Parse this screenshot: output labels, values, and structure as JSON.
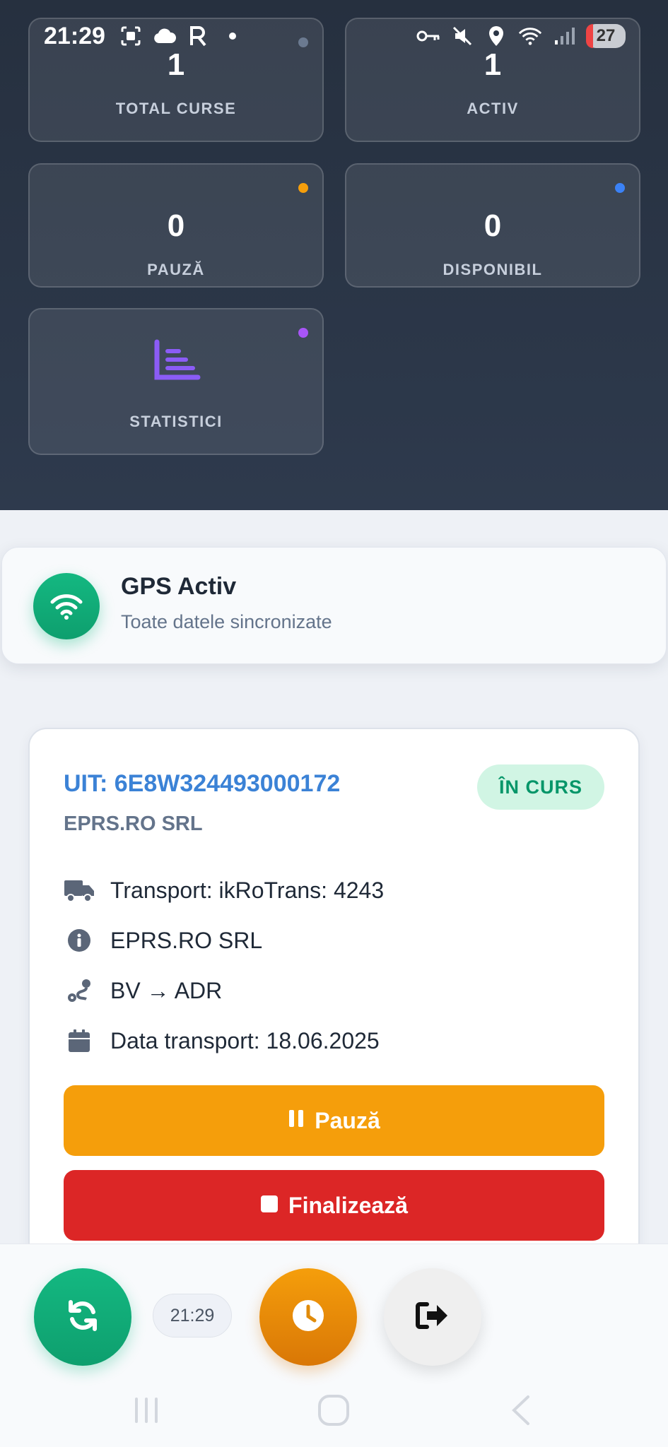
{
  "status_bar": {
    "time": "21:29",
    "battery": "27",
    "left_icons": [
      "screenshot-icon",
      "cloud-icon",
      "r-icon",
      "dot-icon"
    ],
    "right_icons": [
      "key-icon",
      "mute-icon",
      "location-icon",
      "wifi-icon",
      "signal-icon",
      "battery-icon"
    ]
  },
  "stats": [
    {
      "value": "1",
      "label": "TOTAL CURSE",
      "dot_color": "#6b7a90"
    },
    {
      "value": "1",
      "label": "ACTIV",
      "dot_color": "#22c55e"
    },
    {
      "value": "0",
      "label": "PAUZĂ",
      "dot_color": "#f59e0b"
    },
    {
      "value": "0",
      "label": "DISPONIBIL",
      "dot_color": "#3b82f6"
    },
    {
      "label": "STATISTICI",
      "icon": "chart-bar-icon",
      "dot_color": "#a855f7"
    }
  ],
  "gps": {
    "title": "GPS Activ",
    "subtitle": "Toate datele sincronizate",
    "icon": "wifi-icon"
  },
  "transport": {
    "uit": "UIT: 6E8W324493000172",
    "company": "EPRS.RO SRL",
    "status_badge": "ÎN CURS",
    "rows": [
      {
        "icon": "truck-icon",
        "text": "Transport: ikRoTrans: 4243"
      },
      {
        "icon": "info-icon",
        "text": "EPRS.RO SRL"
      },
      {
        "icon": "route-icon",
        "text": "BV → ADR"
      },
      {
        "icon": "calendar-icon",
        "text": "Data transport: 18.06.2025"
      }
    ],
    "pause_label": "Pauză",
    "finish_label": "Finalizează"
  },
  "bottom": {
    "time": "21:29"
  },
  "colors": {
    "accent_green": "#10b981",
    "accent_orange": "#f59e0b",
    "accent_red": "#dc2626",
    "accent_blue": "#3b82d6"
  }
}
